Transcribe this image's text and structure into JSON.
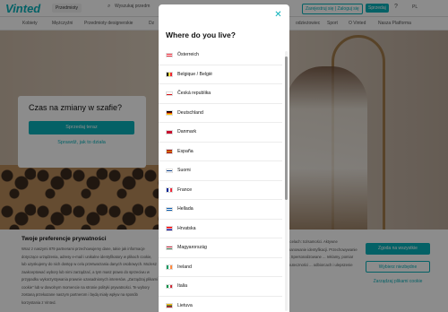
{
  "header": {
    "logo": "Vinted",
    "category_select": "Przedmioty",
    "search_placeholder": "Wyszukaj przedm",
    "signup_button": "Zarejestruj się | Zaloguj się",
    "sell_button": "Sprzedaj",
    "help_icon": "?",
    "language": "PL"
  },
  "nav": {
    "items": [
      "Kobiety",
      "Mężczyźni",
      "Przedmioty designerskie",
      "Dz",
      "odzieżowiec",
      "Sport",
      "O Vinted",
      "Nasza Platforma"
    ]
  },
  "hero": {
    "title": "Czas na zmiany w szafie?",
    "sell_button": "Sprzedaj teraz",
    "how_link": "Sprawdź, jak to działa"
  },
  "cookie": {
    "heading": "Twoje preferencje prywatności",
    "text": "Wraz z naszymi 879 partnerami przechowujemy dane, takie jak informacje dotyczące urządzenia, adresy e-mail i unikalne identyfikatory w plikach cookie, lub uzyskujemy do nich dostęp w celu przetwarzania danych osobowych. Możesz zaakceptować wybory lub nimi zarządzać, a tym masz prawo do sprzeciwu w przypadku wykorzystywania prawnie uzasadnionych interesów. „Zarządzaj plikami cookie” lub w dowolnym momencie na stronie polityki prywatności. Te wybory zostaną przekazane naszym partnerom i będą miały wpływ na sposób korzystania z Vinted.",
    "text_right": "...celach: tożsamości. Aktywne skanowanie identyfikacji. Przechowywanie ... Spersonalizowane ... reklamy, pomiar skuteczności ... odbiorcach i ulepszenie",
    "accept": "Zgoda na wszystkie",
    "reject": "Wybierz niezbędne",
    "customize": "Zarządzaj plikami cookie"
  },
  "modal": {
    "title": "Where do you live?",
    "close_icon": "close-icon",
    "countries": [
      {
        "name": "Österreich",
        "flag": [
          "#ed2939",
          "#ffffff",
          "#ed2939"
        ],
        "dir": "h"
      },
      {
        "name": "Belgique / België",
        "flag": [
          "#000000",
          "#fae042",
          "#ed2939"
        ],
        "dir": "v"
      },
      {
        "name": "Česká republika",
        "flag": [
          "#ffffff",
          "#ffffff",
          "#d7141a"
        ],
        "dir": "h"
      },
      {
        "name": "Deutschland",
        "flag": [
          "#000000",
          "#dd0000",
          "#ffce00"
        ],
        "dir": "h"
      },
      {
        "name": "Danmark",
        "flag": [
          "#c8102e",
          "#c8102e",
          "#c8102e"
        ],
        "dir": "h"
      },
      {
        "name": "España",
        "flag": [
          "#aa151b",
          "#f1bf00",
          "#aa151b"
        ],
        "dir": "h"
      },
      {
        "name": "Suomi",
        "flag": [
          "#ffffff",
          "#003580",
          "#ffffff"
        ],
        "dir": "h"
      },
      {
        "name": "France",
        "flag": [
          "#002395",
          "#ffffff",
          "#ed2939"
        ],
        "dir": "v"
      },
      {
        "name": "Hellada",
        "flag": [
          "#0d5eaf",
          "#ffffff",
          "#0d5eaf"
        ],
        "dir": "h"
      },
      {
        "name": "Hrvatska",
        "flag": [
          "#ff0000",
          "#ffffff",
          "#171796"
        ],
        "dir": "h"
      },
      {
        "name": "Magyarország",
        "flag": [
          "#cd2a3e",
          "#ffffff",
          "#436f4d"
        ],
        "dir": "h"
      },
      {
        "name": "Ireland",
        "flag": [
          "#169b62",
          "#ffffff",
          "#ff883e"
        ],
        "dir": "v"
      },
      {
        "name": "Italia",
        "flag": [
          "#009246",
          "#ffffff",
          "#ce2b37"
        ],
        "dir": "v"
      },
      {
        "name": "Lietuva",
        "flag": [
          "#fdb913",
          "#006a44",
          "#c1272d"
        ],
        "dir": "h"
      }
    ]
  }
}
